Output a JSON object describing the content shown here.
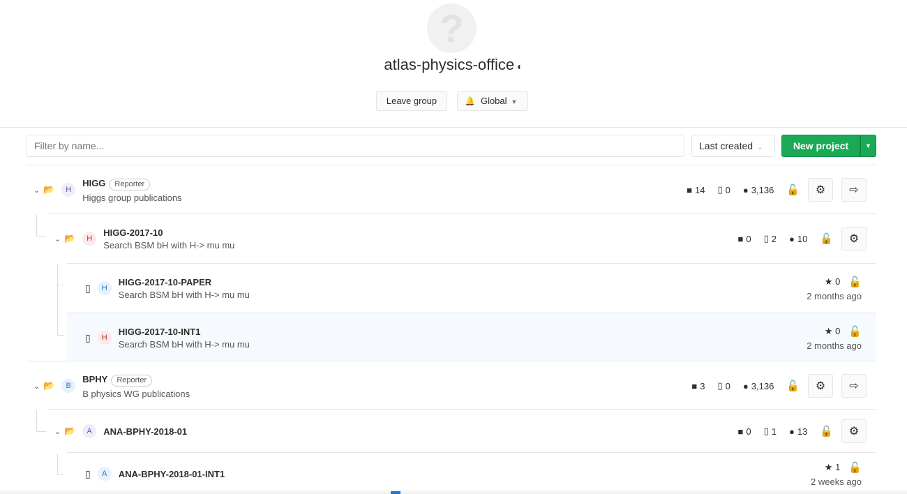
{
  "group": {
    "avatar_glyph": "?",
    "name": "atlas-physics-office",
    "visibility_icon": "shield-icon",
    "leave_label": "Leave group",
    "notification_label": "Global"
  },
  "toolbar": {
    "filter_placeholder": "Filter by name...",
    "sort_label": "Last created",
    "new_project_label": "New project"
  },
  "rows": [
    {
      "name": "HIGG",
      "role": "Reporter",
      "letter": "H",
      "description": "Higgs group publications",
      "subgroups": "14",
      "projects": "0",
      "members": "3,136"
    },
    {
      "name": "HIGG-2017-10",
      "letter": "H",
      "description": "Search BSM bH with H-> mu mu",
      "subgroups": "0",
      "projects": "2",
      "members": "10"
    },
    {
      "name": "HIGG-2017-10-PAPER",
      "letter": "H",
      "description": "Search BSM bH with H-> mu mu",
      "stars": "0",
      "time": "2 months ago"
    },
    {
      "name": "HIGG-2017-10-INT1",
      "letter": "H",
      "description": "Search BSM bH with H-> mu mu",
      "stars": "0",
      "time": "2 months ago"
    },
    {
      "name": "BPHY",
      "role": "Reporter",
      "letter": "B",
      "description": "B physics WG publications",
      "subgroups": "3",
      "projects": "0",
      "members": "3,136"
    },
    {
      "name": "ANA-BPHY-2018-01",
      "letter": "A",
      "description": "",
      "subgroups": "0",
      "projects": "1",
      "members": "13"
    },
    {
      "name": "ANA-BPHY-2018-01-INT1",
      "letter": "A",
      "description": "",
      "stars": "1",
      "time": "2 weeks ago"
    }
  ],
  "colors": {
    "accent_green": "#1aaa55",
    "highlight_row": "#f6fafe"
  }
}
